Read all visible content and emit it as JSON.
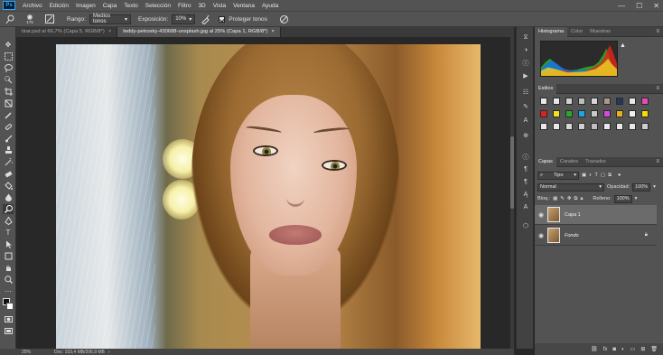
{
  "app": {
    "logo_text": "Ps"
  },
  "menu": [
    "Archivo",
    "Edición",
    "Imagen",
    "Capa",
    "Texto",
    "Selección",
    "Filtro",
    "3D",
    "Vista",
    "Ventana",
    "Ayuda"
  ],
  "window_controls": {
    "minimize": "—",
    "maximize": "☐",
    "close": "✕"
  },
  "options": {
    "brush_size": "175",
    "range_label": "Rango:",
    "range_value": "Medios tonos",
    "exposure_label": "Exposición:",
    "exposure_value": "10%",
    "protect_label": "Proteger tonos"
  },
  "documents": [
    {
      "title": "tirar.psd al 66,7% (Capa 5, RGB/8*)",
      "close": "×",
      "active": false
    },
    {
      "title": "teddy-petrosky-430688-unsplash.jpg al 25% (Capa 1, RGB/8*)",
      "close": "×",
      "active": true
    }
  ],
  "status": {
    "zoom": "25%",
    "doc": "Doc: 103,4 MB/206,9 MB"
  },
  "panels": {
    "histogram": {
      "tabs": [
        "Histograma",
        "Color",
        "Muestras"
      ]
    },
    "styles": {
      "title": "Estilos",
      "swatch_colors": [
        "#e8e8e8",
        "#e8e8e8",
        "#d0d0d0",
        "#bdbdbd",
        "#d7d7d7",
        "#a89a87",
        "#1f3a5a",
        "#e8e8e8",
        "#e84bb8",
        "#e0201c",
        "#f2e11a",
        "#2aa82a",
        "#1aa7e6",
        "#c8c8c8",
        "#d54ad9",
        "#e6b21a",
        "#f0f0f0",
        "#f0e000",
        "#e8e8e8",
        "#e8e8e8",
        "#d9d9d9",
        "#cfcfcf",
        "#bebebe",
        "#e8e8e8",
        "#e8e8e8",
        "#e8e8e8",
        "#cfcfcf"
      ]
    },
    "layers": {
      "tabs": [
        "Capas",
        "Canales",
        "Trazados"
      ],
      "filter_value": "Tipo",
      "blend_mode": "Normal",
      "opacity_label": "Opacidad:",
      "opacity_value": "100%",
      "lock_label": "Bloq.:",
      "fill_label": "Relleno:",
      "fill_value": "100%",
      "items": [
        {
          "name": "Capa 1",
          "selected": true
        },
        {
          "name": "Fondo",
          "selected": false,
          "locked": true
        }
      ]
    }
  }
}
